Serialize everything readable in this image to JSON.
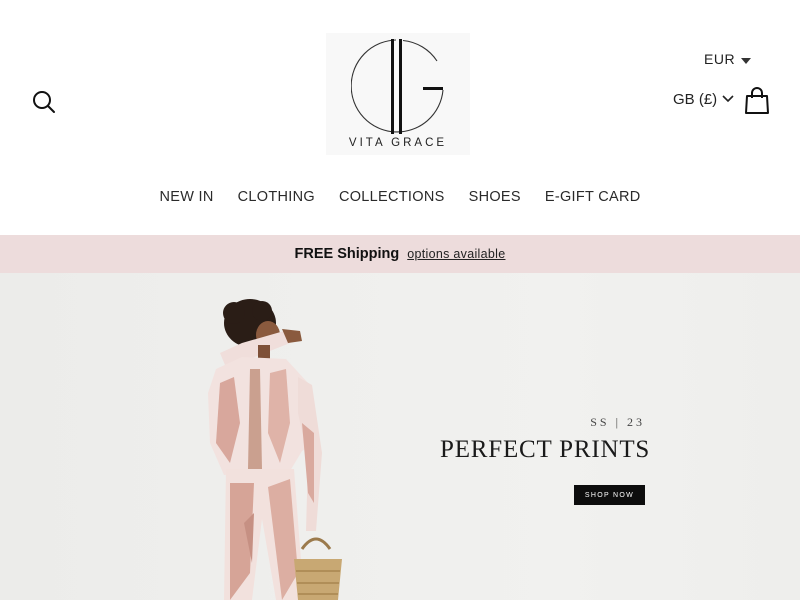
{
  "brand": {
    "name": "VITA GRACE"
  },
  "header": {
    "search_icon": "search-icon",
    "cart_icon": "shopping-bag-icon",
    "currency_primary": "EUR",
    "currency_secondary": "GB (£)"
  },
  "nav": {
    "items": [
      {
        "label": "NEW IN"
      },
      {
        "label": "CLOTHING"
      },
      {
        "label": "COLLECTIONS"
      },
      {
        "label": "SHOES"
      },
      {
        "label": "E-GIFT CARD"
      }
    ]
  },
  "announcement": {
    "bold": "FREE Shipping",
    "link": "options available",
    "background": "#eddcdc"
  },
  "hero": {
    "season": "SS | 23",
    "headline": "PERFECT PRINTS",
    "cta": "SHOP NOW",
    "background": "#efefed"
  }
}
